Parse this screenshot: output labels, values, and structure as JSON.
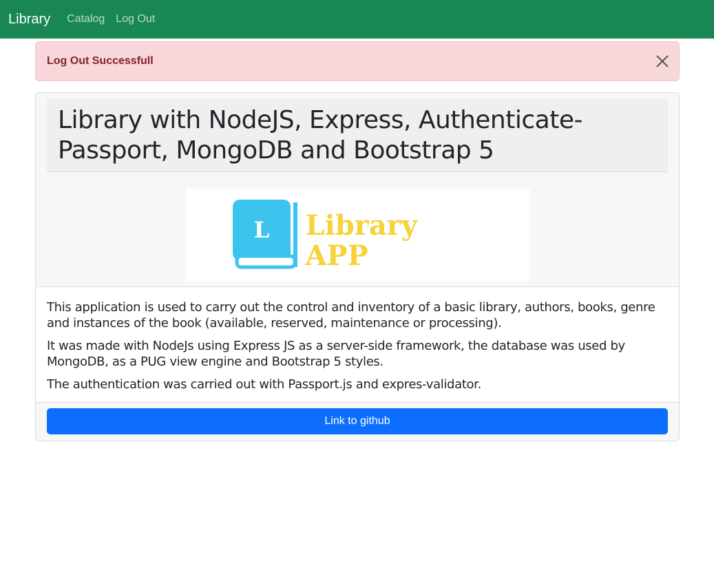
{
  "navbar": {
    "brand": "Library",
    "links": [
      "Catalog",
      "Log Out"
    ],
    "color": "#198754"
  },
  "alert": {
    "message": "Log Out Successfull",
    "close_icon": "close-icon"
  },
  "card": {
    "title": "Library with NodeJS, Express, Authenticate-Passport, MongoDB and Bootstrap 5",
    "logo": {
      "letter": "L",
      "line1": "Library",
      "line2": "APP",
      "book_color": "#3cc4ee",
      "text_color": "#f6d23b"
    },
    "paragraphs": [
      "This application is used to carry out the control and inventory of a basic library, authors, books, genre and instances of the book (available, reserved, maintenance or processing).",
      "It was made with NodeJs using Express JS as a server-side framework, the database was used by MongoDB, as a PUG view engine and Bootstrap 5 styles.",
      "The authentication was carried out with Passport.js and expres-validator."
    ],
    "button_label": "Link to github",
    "button_color": "#0d6efd"
  }
}
